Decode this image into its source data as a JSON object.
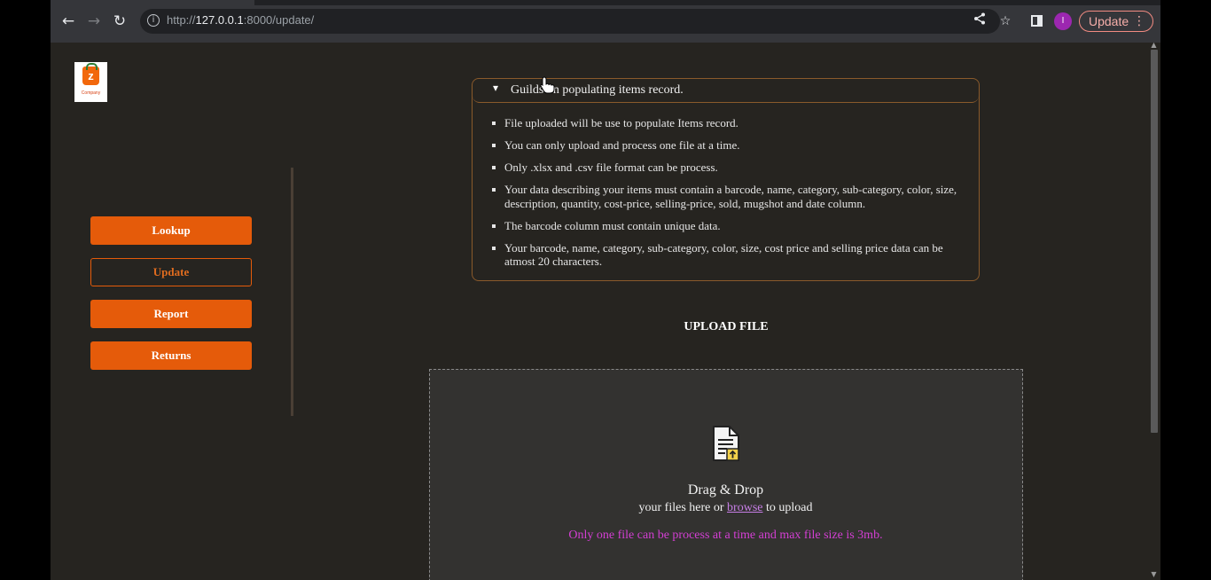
{
  "browser": {
    "url_prefix": "http://",
    "url_host": "127.0.0.1",
    "url_rest": ":8000/update/",
    "avatar_letter": "I",
    "update_button": "Update",
    "icons": [
      "back-icon",
      "forward-icon",
      "reload-icon",
      "info-icon",
      "share-icon",
      "star-icon",
      "side-panel-icon",
      "more-icon"
    ]
  },
  "logo": {
    "mark": "z",
    "label": "Company"
  },
  "sidebar": {
    "items": [
      {
        "label": "Lookup",
        "active": false
      },
      {
        "label": "Update",
        "active": true
      },
      {
        "label": "Report",
        "active": false
      },
      {
        "label": "Returns",
        "active": false
      }
    ]
  },
  "guide": {
    "title": "Guilds on populating items record.",
    "items": [
      "File uploaded will be use to populate Items record.",
      "You can only upload and process one file at a time.",
      "Only .xlsx and .csv file format can be process.",
      "Your data describing your items must contain a barcode, name, category, sub-category, color, size, description, quantity, cost-price, selling-price, sold, mugshot and date column.",
      "The barcode column must contain unique data.",
      "Your barcode, name, category, sub-category, color, size, cost price and selling price data can be atmost 20 characters."
    ]
  },
  "upload": {
    "title": "UPLOAD FILE",
    "drag_title": "Drag & Drop",
    "sub_before": "your files here or ",
    "browse": "browse",
    "sub_after": " to upload",
    "note": "Only one file can be process at a time and max file size is 3mb."
  },
  "colors": {
    "accent": "#e55b0a",
    "page_bg": "#262420",
    "note": "#d43fd4",
    "link": "#c77ee6"
  }
}
